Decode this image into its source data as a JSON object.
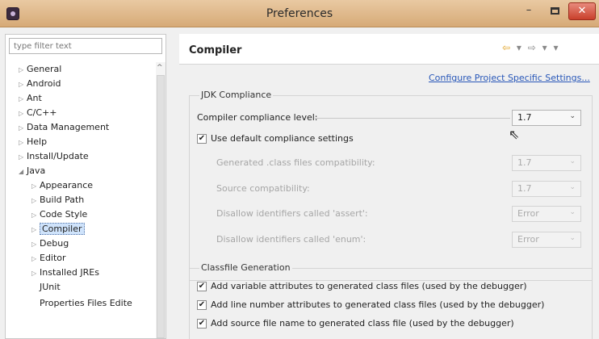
{
  "window": {
    "title": "Preferences",
    "minimize": "–",
    "close": "✕"
  },
  "sidebar": {
    "filter_placeholder": "type filter text",
    "items": [
      {
        "label": "General",
        "arrow": "▷"
      },
      {
        "label": "Android",
        "arrow": "▷"
      },
      {
        "label": "Ant",
        "arrow": "▷"
      },
      {
        "label": "C/C++",
        "arrow": "▷"
      },
      {
        "label": "Data Management",
        "arrow": "▷"
      },
      {
        "label": "Help",
        "arrow": "▷"
      },
      {
        "label": "Install/Update",
        "arrow": "▷"
      },
      {
        "label": "Java",
        "arrow": "◢"
      },
      {
        "label": "Appearance",
        "arrow": "▷"
      },
      {
        "label": "Build Path",
        "arrow": "▷"
      },
      {
        "label": "Code Style",
        "arrow": "▷"
      },
      {
        "label": "Compiler",
        "arrow": "▷"
      },
      {
        "label": "Debug",
        "arrow": "▷"
      },
      {
        "label": "Editor",
        "arrow": "▷"
      },
      {
        "label": "Installed JREs",
        "arrow": "▷"
      },
      {
        "label": "JUnit",
        "arrow": ""
      },
      {
        "label": "Properties Files Edite",
        "arrow": ""
      }
    ]
  },
  "main": {
    "title": "Compiler",
    "config_link": "Configure Project Specific Settings...",
    "jdk": {
      "group_title": "JDK Compliance",
      "compliance_label": "Compiler compliance level:",
      "compliance_value": "1.7",
      "use_default_label": "Use default compliance settings",
      "use_default_checked": "✔",
      "generated_label": "Generated .class files compatibility:",
      "generated_value": "1.7",
      "source_label": "Source compatibility:",
      "source_value": "1.7",
      "assert_label": "Disallow identifiers called 'assert':",
      "assert_value": "Error",
      "enum_label": "Disallow identifiers called 'enum':",
      "enum_value": "Error"
    },
    "classfile": {
      "group_title": "Classfile Generation",
      "options": [
        {
          "label": "Add variable attributes to generated class files (used by the debugger)",
          "checked": "✔"
        },
        {
          "label": "Add line number attributes to generated class files (used by the debugger)",
          "checked": "✔"
        },
        {
          "label": "Add source file name to generated class file (used by the debugger)",
          "checked": "✔"
        }
      ]
    }
  },
  "icons": {
    "back": "⇦",
    "forward": "⇨",
    "dropdown": "▾",
    "select_chevron": "⌄"
  }
}
